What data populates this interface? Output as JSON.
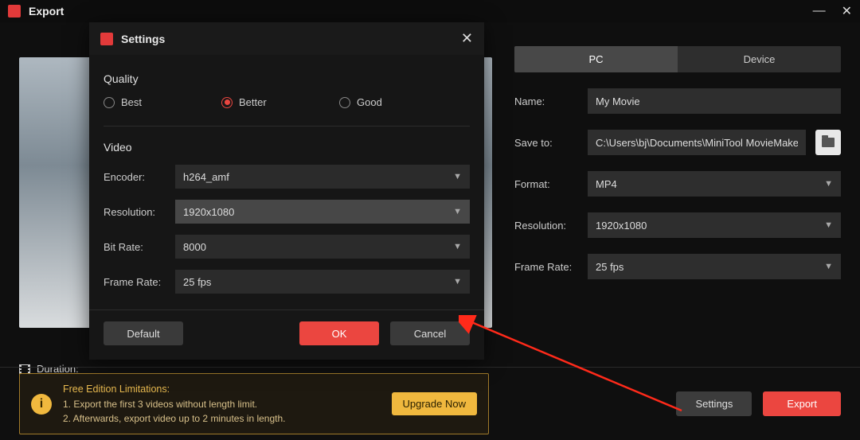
{
  "titlebar": {
    "title": "Export"
  },
  "preview": {
    "duration_label": "Duration:"
  },
  "right": {
    "tabs": {
      "pc": "PC",
      "device": "Device"
    },
    "name": {
      "label": "Name:",
      "value": "My Movie"
    },
    "saveto": {
      "label": "Save to:",
      "value": "C:\\Users\\bj\\Documents\\MiniTool MovieMaker\\outp"
    },
    "format": {
      "label": "Format:",
      "value": "MP4"
    },
    "resolution": {
      "label": "Resolution:",
      "value": "1920x1080"
    },
    "framerate": {
      "label": "Frame Rate:",
      "value": "25 fps"
    }
  },
  "limits": {
    "title": "Free Edition Limitations:",
    "line1": "1. Export the first 3 videos without length limit.",
    "line2": "2. Afterwards, export video up to 2 minutes in length.",
    "upgrade": "Upgrade Now"
  },
  "bottom": {
    "settings": "Settings",
    "export": "Export"
  },
  "settings": {
    "title": "Settings",
    "quality": {
      "head": "Quality",
      "best": "Best",
      "better": "Better",
      "good": "Good"
    },
    "video": {
      "head": "Video",
      "encoder": {
        "label": "Encoder:",
        "value": "h264_amf"
      },
      "resolution": {
        "label": "Resolution:",
        "value": "1920x1080"
      },
      "bitrate": {
        "label": "Bit Rate:",
        "value": "8000"
      },
      "framerate": {
        "label": "Frame Rate:",
        "value": "25 fps"
      }
    },
    "footer": {
      "default": "Default",
      "ok": "OK",
      "cancel": "Cancel"
    }
  }
}
